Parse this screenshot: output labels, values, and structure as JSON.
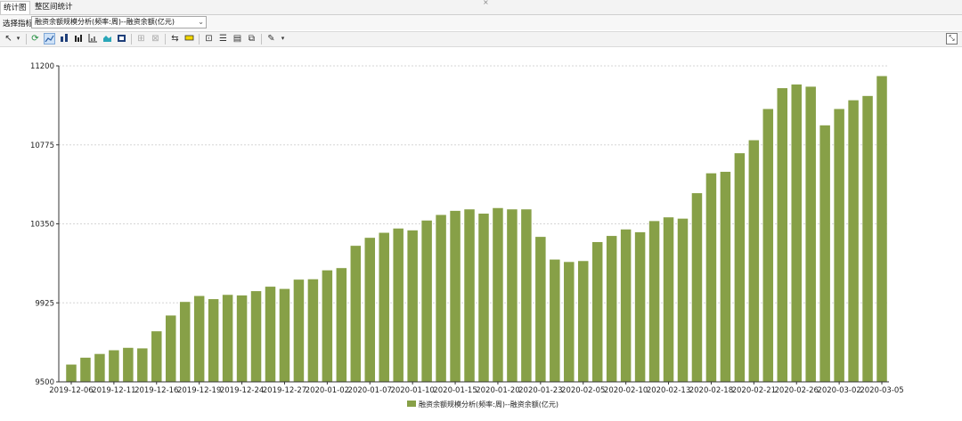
{
  "tabs": [
    {
      "label": "统计图",
      "active": true
    },
    {
      "label": "整区间统计",
      "active": false
    }
  ],
  "tab_close_glyph": "×",
  "selector": {
    "label": "选择指标",
    "value": "融资余额规模分析(频率:周)--融资余额(亿元)"
  },
  "toolbar_icons": [
    "cursor-icon",
    "dropdown-arrow-icon",
    "refresh-icon",
    "line-chart-icon",
    "bar-chart-icon",
    "column-chart-icon",
    "scatter-chart-icon",
    "area-chart-icon",
    "stacked-chart-icon",
    "zoom-in-icon",
    "zoom-out-icon",
    "swap-axes-icon",
    "highlight-icon",
    "data-table-icon",
    "list-icon",
    "grid-icon",
    "copy-icon",
    "brush-icon",
    "dropdown-arrow-icon",
    "restore-window-icon"
  ],
  "colors": {
    "bar": "#87A047",
    "grid": "#d6d6d6",
    "axis": "#333333"
  },
  "chart_data": {
    "type": "bar",
    "title": "",
    "xlabel": "",
    "ylabel": "",
    "ylim": [
      9500,
      11200
    ],
    "yticks": [
      9500,
      9925,
      10350,
      10775,
      11200
    ],
    "grid": "horizontal-dotted",
    "legend_placement": "bottom-center",
    "x_tick_labels": [
      "2019-12-06",
      "2019-12-11",
      "2019-12-16",
      "2019-12-19",
      "2019-12-24",
      "2019-12-27",
      "2020-01-02",
      "2020-01-07",
      "2020-01-10",
      "2020-01-15",
      "2020-01-20",
      "2020-01-23",
      "2020-02-05",
      "2020-02-10",
      "2020-02-13",
      "2020-02-18",
      "2020-02-21",
      "2020-02-26",
      "2020-03-02",
      "2020-03-05"
    ],
    "series": [
      {
        "name": "融资余额规模分析(频率:周)--融资余额(亿元)",
        "values": [
          9593,
          9630,
          9650,
          9670,
          9683,
          9680,
          9772,
          9857,
          9930,
          9962,
          9945,
          9968,
          9965,
          9988,
          10012,
          10000,
          10050,
          10052,
          10100,
          10112,
          10232,
          10275,
          10302,
          10325,
          10315,
          10368,
          10398,
          10420,
          10428,
          10405,
          10435,
          10428,
          10428,
          10280,
          10158,
          10145,
          10150,
          10252,
          10285,
          10320,
          10305,
          10365,
          10385,
          10378,
          10515,
          10622,
          10630,
          10730,
          10800,
          10968,
          11080,
          11100,
          11088,
          10880,
          10968,
          11015,
          11038,
          11145
        ]
      }
    ]
  }
}
